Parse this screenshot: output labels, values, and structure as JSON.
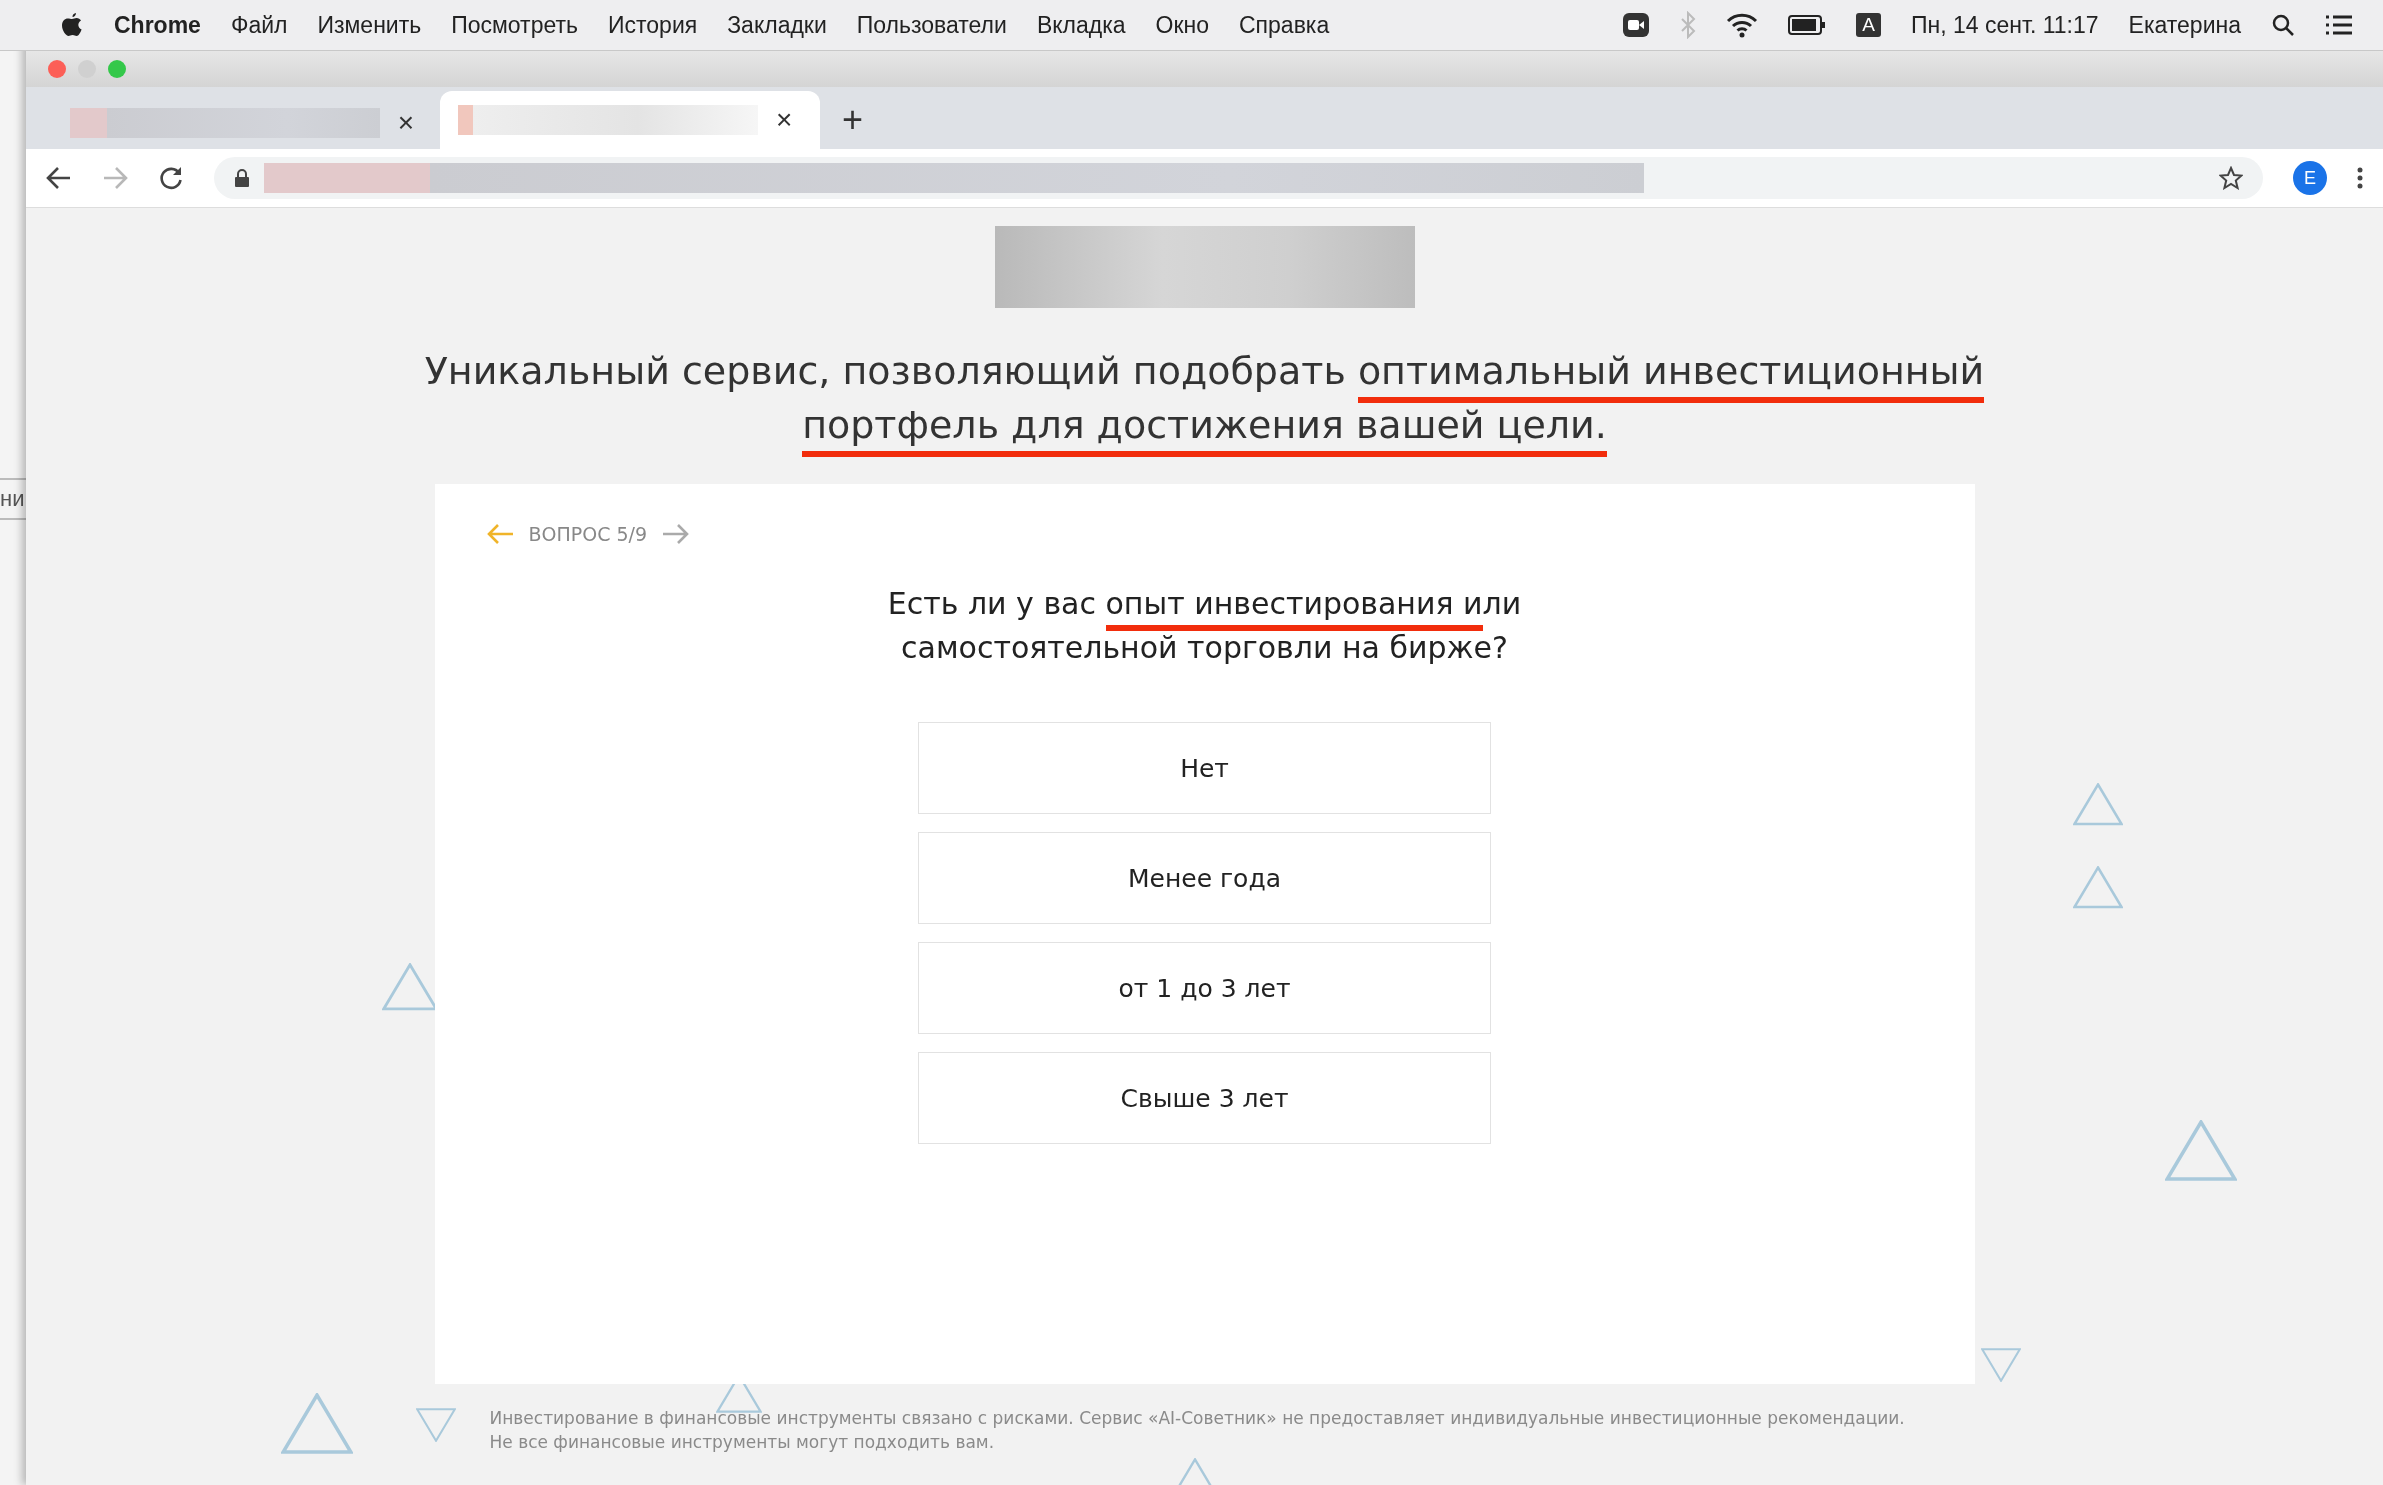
{
  "menubar": {
    "app": "Chrome",
    "items": [
      "Файл",
      "Изменить",
      "Посмотреть",
      "История",
      "Закладки",
      "Пользователи",
      "Вкладка",
      "Окно",
      "Справка"
    ],
    "bluetooth_on": false,
    "input_source": "A",
    "datetime": "Пн, 14 сент. 11:17",
    "user": "Екатерина"
  },
  "background_window": {
    "text": "ни"
  },
  "tabs": [
    {
      "selected": false,
      "close": "×"
    },
    {
      "selected": true,
      "close": "×"
    }
  ],
  "new_tab": "+",
  "toolbar": {
    "forward_disabled": true,
    "avatar": "E"
  },
  "headline": [
    {
      "text": "Уникальный сервис, позволяющий подобрать ",
      "marked": false
    },
    {
      "text": "оптимальный инвестиционный портфель для достижения вашей цели.",
      "marked": true
    }
  ],
  "quiz": {
    "counter": "ВОПРОС 5/9",
    "question": [
      {
        "text": "Есть ли у вас ",
        "marked": false
      },
      {
        "text": "опыт инвестирования и",
        "marked": true
      },
      {
        "text": "ли самостоятельной торговли на бирже?",
        "marked": false
      }
    ],
    "options": [
      "Нет",
      "Менее года",
      "от 1 до 3 лет",
      "Свыше 3 лет"
    ]
  },
  "disclaimer": "Инвестирование в финансовые инструменты связано с рисками. Сервис «AI-Советник» не предоставляет индивидуальные инвестиционные рекомендации. Не все финансовые инструменты могут подходить вам."
}
